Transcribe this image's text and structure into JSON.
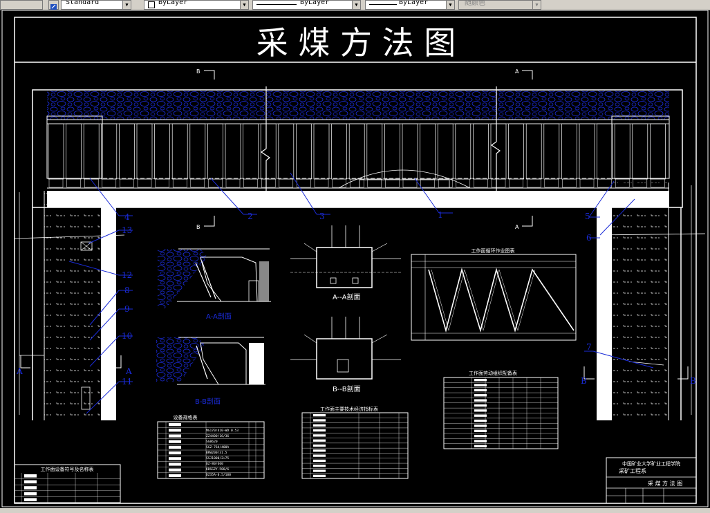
{
  "toolbar": {
    "text_style": "Standard",
    "layer": "ByLayer",
    "linetype": "ByLayer",
    "lineweight": "ByLayer",
    "plot_style": "随颜色"
  },
  "drawing": {
    "title": "采 煤 方 法 图",
    "labels": {
      "l1": "1",
      "l2": "2",
      "l3": "3",
      "l4": "4",
      "l5": "5",
      "l6": "6",
      "l7": "7",
      "l8": "8",
      "l9": "9",
      "l10": "10",
      "l11": "11",
      "l12": "12",
      "l13": "13",
      "a_left": "A",
      "a_right": "A",
      "b_left": "B",
      "b_right": "B"
    },
    "section_aa_small": "A-A剖面",
    "section_bb_small": "B-B剖面",
    "section_aa": "A--A剖面",
    "section_bb": "B--B剖面",
    "cycle_chart_title": "工作面循环作业图表",
    "labor_table_title": "工作面劳动组织配备表",
    "equipment_table_title": "设备规格表",
    "tech_table_title": "工作面主要技术经济指标表",
    "legend_table_title": "工作面设备符号及名称表",
    "equipment_models": [
      "MG170/410-WD 0.53",
      "ZZ4400/16/36",
      "SGB620",
      "SGZ-764/400A",
      "BRW200/31.5",
      "SSJ1000/2×75",
      "QZ-80/660",
      "KBSGZY-500/6",
      "DZ35A-0.5/100"
    ],
    "title_block_school": "中国矿业大学矿业工程学院",
    "title_block_dept": "采矿工程系",
    "title_block_name": "采 煤 方 法 图"
  }
}
